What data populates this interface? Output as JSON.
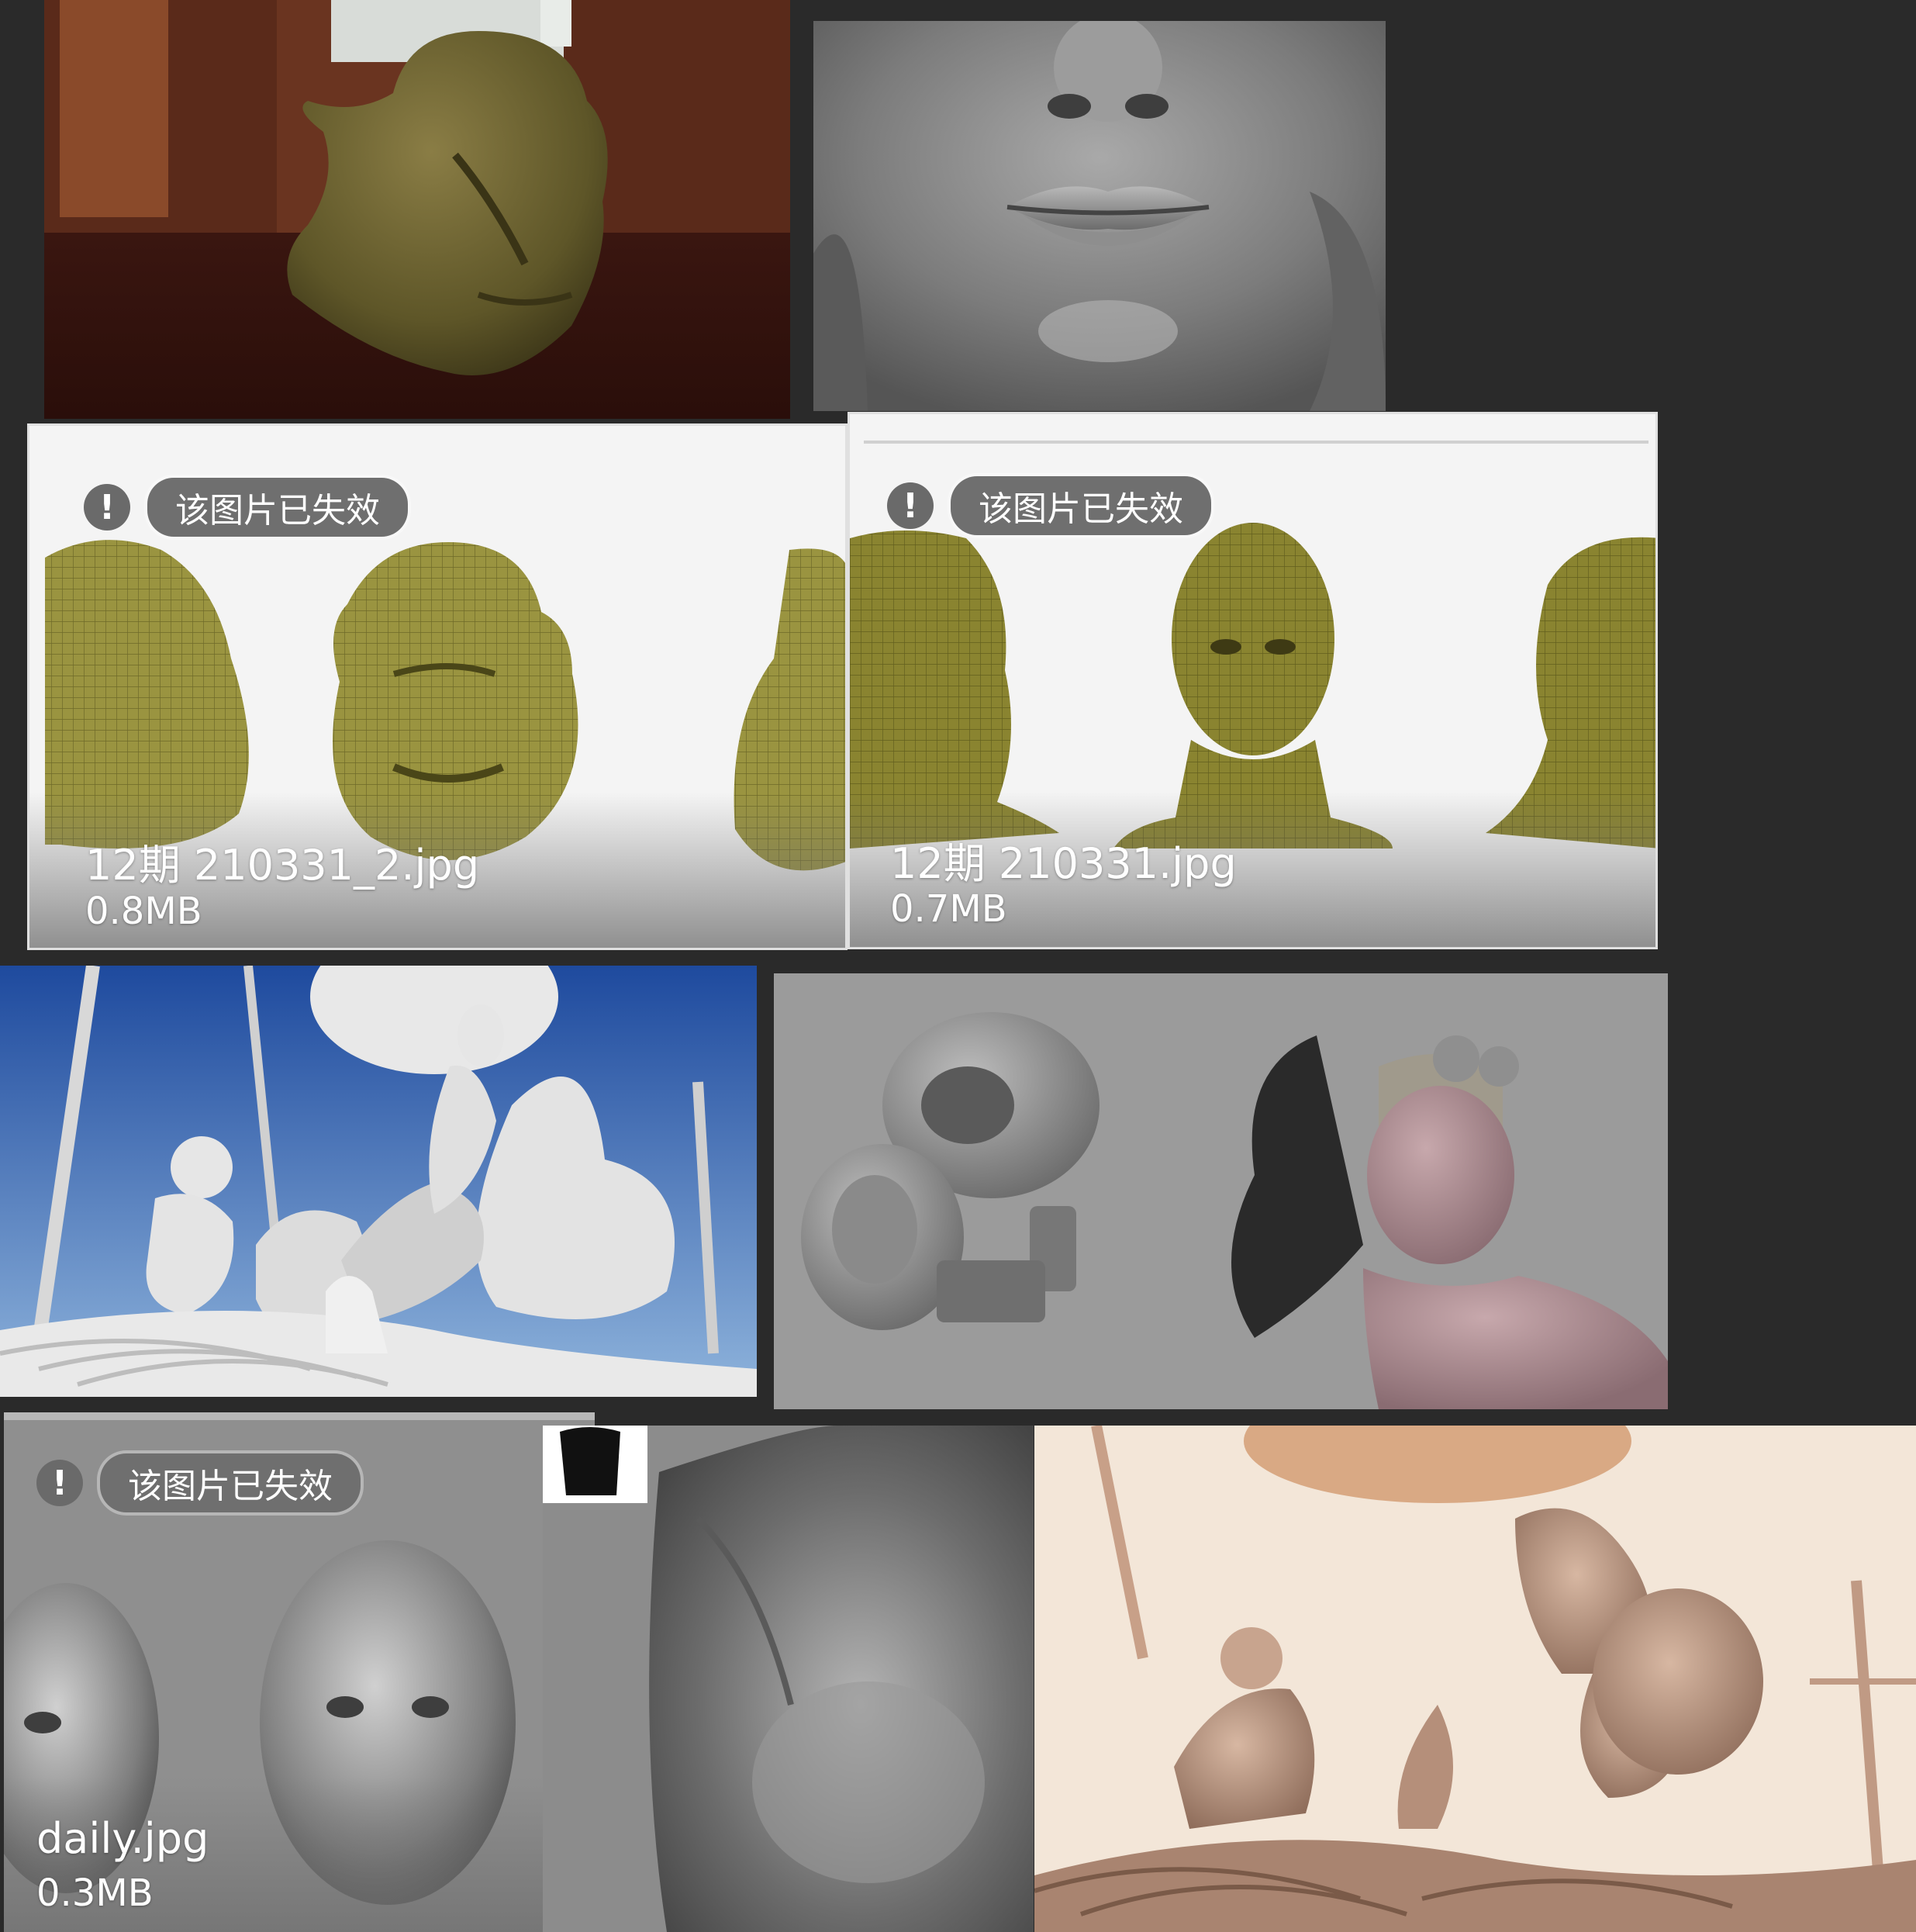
{
  "colors": {
    "background": "#2a2a2a",
    "badge": "#6f6f6f",
    "sculpt_olive": "#8d8a3a",
    "sculpt_gray": "#8c8c8c",
    "sculpt_clay": "#c9a994"
  },
  "tiles": [
    {
      "kind": "render",
      "subject": "ogre-head-render-room"
    },
    {
      "kind": "render",
      "subject": "female-lips-closeup"
    },
    {
      "kind": "file-card",
      "warning_icon": "!",
      "warning": "该图片已失效",
      "filename": "12期 210331_2.jpg",
      "size": "0.8MB",
      "subject": "ogre-head-turnaround"
    },
    {
      "kind": "file-card",
      "warning_icon": "!",
      "warning": "该图片已失效",
      "filename": "12期 210331.jpg",
      "size": "0.7MB",
      "subject": "female-head-turnaround"
    },
    {
      "kind": "render",
      "subject": "girls-on-machine-scene-blue-sky"
    },
    {
      "kind": "render",
      "subject": "helmet-and-girl-bust"
    },
    {
      "kind": "file-card",
      "warning_icon": "!",
      "warning": "该图片已失效",
      "filename": "daily.jpg",
      "size": "0.3MB",
      "subject": "gray-female-heads"
    },
    {
      "kind": "render",
      "subject": "female-torso-closeup"
    },
    {
      "kind": "render",
      "subject": "clay-machine-scene"
    }
  ]
}
